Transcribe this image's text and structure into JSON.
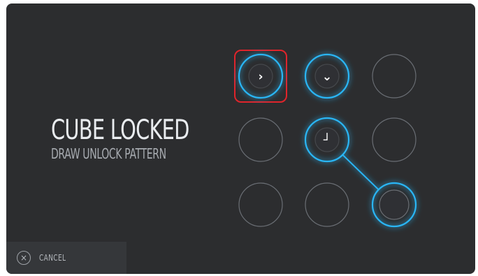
{
  "lock_screen": {
    "title": "CUBE LOCKED",
    "subtitle": "DRAW UNLOCK PATTERN"
  },
  "pattern": {
    "nodes": [
      {
        "row": 0,
        "col": 0,
        "selected": true,
        "glyph": "›",
        "icon": "chevron-right-icon",
        "highlighted": true
      },
      {
        "row": 0,
        "col": 1,
        "selected": true,
        "glyph": "⌄",
        "icon": "chevron-down-icon",
        "highlighted": false
      },
      {
        "row": 0,
        "col": 2,
        "selected": false,
        "glyph": "",
        "icon": "",
        "highlighted": false
      },
      {
        "row": 1,
        "col": 0,
        "selected": false,
        "glyph": "",
        "icon": "",
        "highlighted": false
      },
      {
        "row": 1,
        "col": 1,
        "selected": true,
        "glyph": "┘",
        "icon": "corner-arrow-icon",
        "highlighted": false
      },
      {
        "row": 1,
        "col": 2,
        "selected": false,
        "glyph": "",
        "icon": "",
        "highlighted": false
      },
      {
        "row": 2,
        "col": 0,
        "selected": false,
        "glyph": "",
        "icon": "",
        "highlighted": false
      },
      {
        "row": 2,
        "col": 1,
        "selected": false,
        "glyph": "",
        "icon": "",
        "highlighted": false
      },
      {
        "row": 2,
        "col": 2,
        "selected": true,
        "glyph": "",
        "icon": "",
        "highlighted": false
      }
    ],
    "path_order": [
      0,
      1,
      4,
      8
    ],
    "colors": {
      "active": "#29b6f6",
      "inactive": "#6a6e74",
      "highlight": "#e0242b",
      "center_fill": "#2f3034"
    }
  },
  "footer": {
    "cancel_label": "CANCEL",
    "cancel_icon": "close-icon",
    "cancel_glyph": "×"
  }
}
